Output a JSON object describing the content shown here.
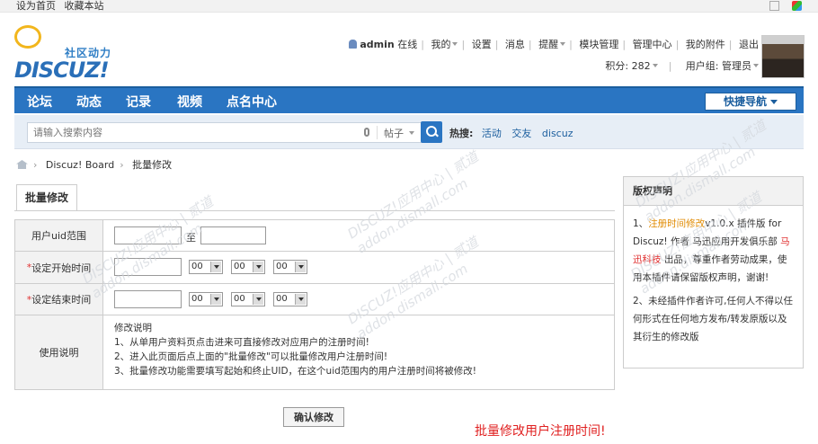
{
  "topbar": {
    "set_home": "设为首页",
    "bookmark": "收藏本站"
  },
  "logo": {
    "subtitle": "社区动力",
    "brand": "DISCUZ!"
  },
  "user": {
    "name": "admin",
    "status": "在线",
    "mine": "我的",
    "settings": "设置",
    "messages": "消息",
    "reminders": "提醒",
    "module_admin": "模块管理",
    "admin_center": "管理中心",
    "attachments": "我的附件",
    "logout": "退出",
    "points_label": "积分: 282",
    "group_label": "用户组: 管理员"
  },
  "nav": {
    "items": [
      "论坛",
      "动态",
      "记录",
      "视频",
      "点名中心"
    ],
    "quick_nav": "快捷导航"
  },
  "search": {
    "placeholder": "请输入搜索内容",
    "type": "帖子",
    "hot_label": "热搜:",
    "hot_items": [
      "活动",
      "交友",
      "discuz"
    ]
  },
  "breadcrumb": {
    "site": "Discuz! Board",
    "current": "批量修改"
  },
  "tab": {
    "label": "批量修改"
  },
  "form": {
    "uid_label": "用户uid范围",
    "to": "至",
    "start_label": "设定开始时间",
    "end_label": "设定结束时间",
    "required_mark": "*",
    "time_value": "00",
    "usage_label": "使用说明",
    "notes": [
      "修改说明",
      "1、从单用户资料页点击进来可直接修改对应用户的注册时间!",
      "2、进入此页面后点上面的\"批量修改\"可以批量修改用户注册时间!",
      "3、批量修改功能需要填写起始和终止UID，在这个uid范围内的用户注册时间将被修改!"
    ],
    "submit": "确认修改"
  },
  "annotation": "批量修改用户注册时间!",
  "copyright": {
    "title": "版权声明",
    "p1_prefix": "1、",
    "p1_link": "注册时间修改",
    "p1_mid": "v1.0.x 插件版 for Discuz! 作者 马迅应用开发俱乐部",
    "p1_author": "马迅科技",
    "p1_suffix": "出品，尊重作者劳动成果，使用本插件请保留版权声明，谢谢!",
    "p2": "2、未经插件作者许可,任何人不得以任何形式在任何地方发布/转发原版以及其衍生的修改版"
  },
  "watermark": {
    "text": "DISCUZ!应用中心 | 贰道",
    "url": "addon.dismall.com"
  }
}
